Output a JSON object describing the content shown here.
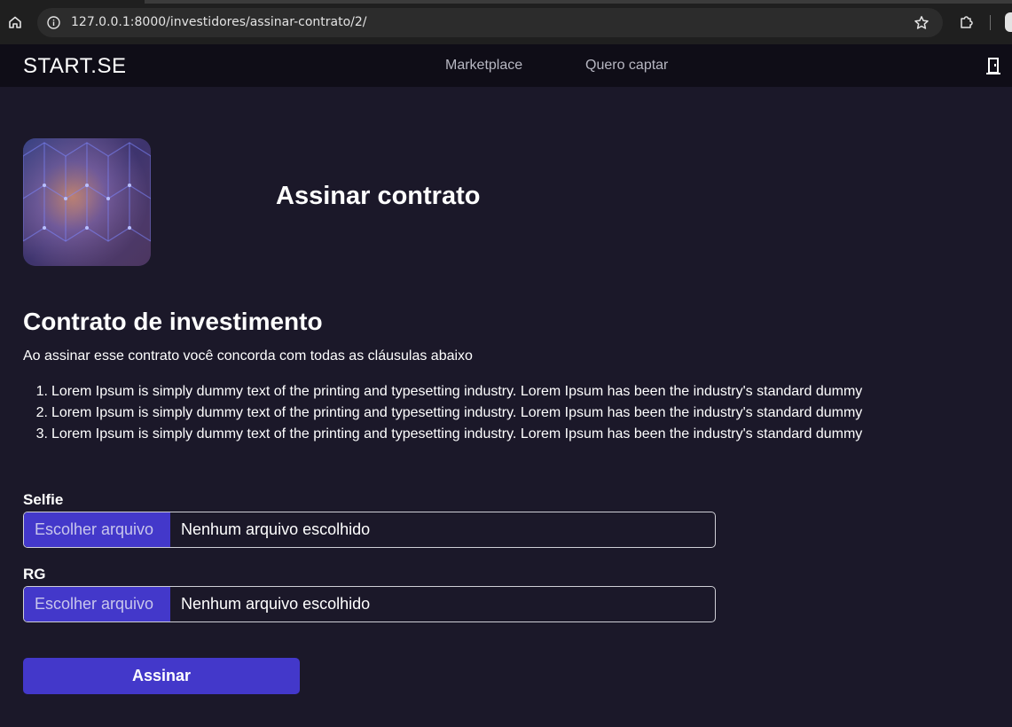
{
  "browser": {
    "url": "127.0.0.1:8000/investidores/assinar-contrato/2/"
  },
  "navbar": {
    "brand": "START.SE",
    "links": [
      "Marketplace",
      "Quero captar"
    ],
    "logout_icon": "door-exit-icon"
  },
  "header": {
    "title": "Assinar contrato",
    "image_icon": "abstract-hexagon-image"
  },
  "contract": {
    "title": "Contrato de investimento",
    "lead": "Ao assinar esse contrato você concorda com todas as cláusulas abaixo",
    "clauses": [
      {
        "num": "1.",
        "text": "Lorem Ipsum is simply dummy text of the printing and typesetting industry. Lorem Ipsum has been the industry's standard dummy"
      },
      {
        "num": "2.",
        "text": "Lorem Ipsum is simply dummy text of the printing and typesetting industry. Lorem Ipsum has been the industry's standard dummy"
      },
      {
        "num": "3.",
        "text": "Lorem Ipsum is simply dummy text of the printing and typesetting industry. Lorem Ipsum has been the industry's standard dummy"
      }
    ]
  },
  "form": {
    "selfie": {
      "label": "Selfie",
      "button": "Escolher arquivo",
      "file": "Nenhum arquivo escolhido"
    },
    "rg": {
      "label": "RG",
      "button": "Escolher arquivo",
      "file": "Nenhum arquivo escolhido"
    },
    "submit": "Assinar"
  },
  "colors": {
    "background": "#1b1829",
    "navbar": "#0f0d17",
    "accent": "#4338ca"
  }
}
